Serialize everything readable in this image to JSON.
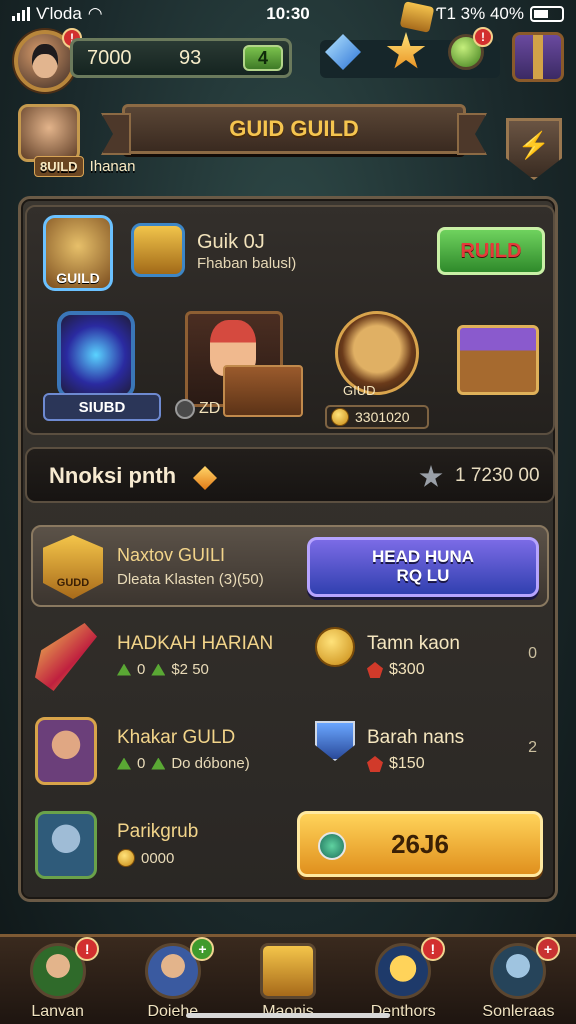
{
  "status_bar": {
    "carrier": "Ѵloda",
    "time": "10:30",
    "battery_text": "Ƭ1 3% 40%"
  },
  "top_bar": {
    "gold_value": "7000",
    "gem_value": "93",
    "plus_label": "4",
    "profile_badge": "!",
    "orb_badge": "!"
  },
  "guild_header": {
    "banner_title": "GUID GUILD",
    "tag": "8UILD",
    "member_name": "Ihanan",
    "shield_glyph": "⚡"
  },
  "guild_card": {
    "emblem_label": "GUILD",
    "title": "Guik 0J",
    "subtitle": "Fhaban balusl)",
    "build_button": "RUILD",
    "portal_label": "SIUBD",
    "hero_label": "ZD",
    "rune_name": "GIUD",
    "rune_price": "3301020"
  },
  "info_strip": {
    "title": "Nnoksi pnth",
    "time": "1 7230  00"
  },
  "featured_row": {
    "emblem_label": "GUDD",
    "title": "Naxtov GUILI",
    "subtitle": "Dleata Klasten (3)(50)",
    "button_label": "HEAD HUNA\nRQ LU"
  },
  "quests": [
    {
      "title": "HADKAH HARIAN",
      "meta_count": "0",
      "meta_price": "$2 50",
      "reward_icon": "coin-icon",
      "reward_title": "Tamn kaon",
      "reward_price": "$300",
      "count": "0"
    },
    {
      "title": "Khakar GULD",
      "meta_count": "0",
      "meta_price": "Do dóbone)",
      "reward_icon": "shield-icon",
      "reward_title": "Barah nans",
      "reward_price": "$150",
      "count": "2"
    },
    {
      "title": "Parikgrub",
      "meta_count": "",
      "meta_price": "0000",
      "button_label": "26J6"
    }
  ],
  "bottom_nav": [
    {
      "label": "Lanvan",
      "badge": "!",
      "badge_color": "#d22f2f"
    },
    {
      "label": "Doiehe",
      "badge": "+",
      "badge_color": "#3f9a2c"
    },
    {
      "label": "Maonis",
      "badge": "",
      "badge_color": ""
    },
    {
      "label": "Denthors",
      "badge": "!",
      "badge_color": "#d22f2f"
    },
    {
      "label": "Sonleraas",
      "badge": "+",
      "badge_color": "#c83232"
    }
  ],
  "colors": {
    "accent_gold": "#f5c54f",
    "build_green": "#6fd25e",
    "action_purple": "#7b6be6",
    "action_orange": "#ffd35a"
  }
}
